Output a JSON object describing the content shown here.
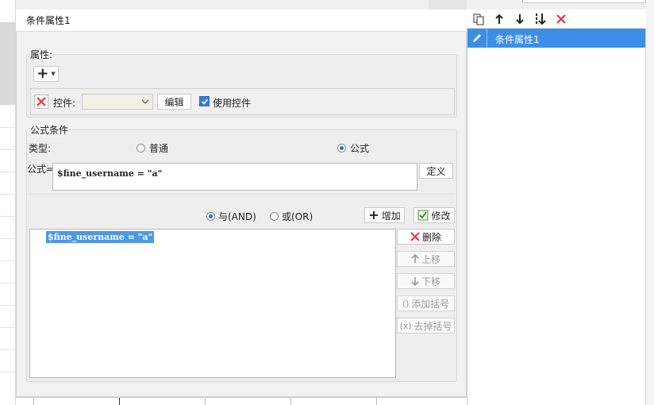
{
  "dialog": {
    "title": "条件属性1"
  },
  "property_group": {
    "legend": "属性:",
    "add_icon": "plus-dropdown-icon",
    "control_label": "控件:",
    "control_value": "",
    "edit_button": "编辑",
    "use_control_label": "使用控件",
    "use_control_checked": true
  },
  "formula_group": {
    "legend": "公式条件",
    "type_label": "类型:",
    "type_options": [
      "普通",
      "公式"
    ],
    "type_selected": "公式",
    "formula_label": "公式=",
    "formula_value": "$fine_username = \"a\"",
    "define_button": "定义"
  },
  "logic": {
    "and_label": "与(AND)",
    "or_label": "或(OR)",
    "selected": "与(AND)",
    "add_button": "增加",
    "modify_button": "修改"
  },
  "condition_list": {
    "items": [
      "$fine_username = \"a\""
    ]
  },
  "side_buttons": {
    "delete": "删除",
    "move_up": "上移",
    "move_down": "下移",
    "add_bracket": "添加括号",
    "remove_bracket": "去掉括号"
  },
  "right_panel": {
    "toolbar_icons": [
      "copy-icon",
      "arrow-up-icon",
      "arrow-down-icon",
      "move-bottom-icon",
      "delete-icon"
    ],
    "items": [
      {
        "label": "条件属性1",
        "selected": true
      }
    ]
  },
  "colors": {
    "selection_blue": "#3d8fe6",
    "delete_red": "#e23a3a",
    "check_blue": "#2f6fb8"
  }
}
